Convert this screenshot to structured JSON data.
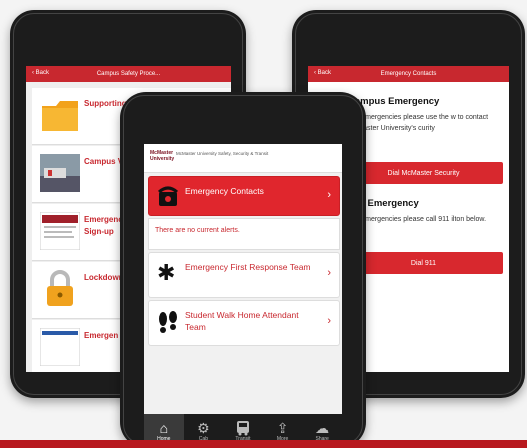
{
  "left_phone": {
    "back_label": "‹ Back",
    "title": "Campus Safety Proce...",
    "rows": [
      {
        "label": "Supporting",
        "icon": "folder-icon"
      },
      {
        "label": "Campus V",
        "icon": "photo-icon"
      },
      {
        "label": "Emergenc\nSign-up",
        "icon": "document-icon"
      },
      {
        "label": "Lockdown",
        "icon": "padlock-icon"
      },
      {
        "label": "Emergen",
        "icon": "document-icon"
      }
    ]
  },
  "right_phone": {
    "back_label": "‹ Back",
    "title": "Emergency Contacts",
    "section1_heading": "Campus Emergency",
    "section1_text": "pus emergencies please use the w to contact McMaster University's curity",
    "button1": "Dial McMaster Security",
    "section2_heading": "pus Emergency",
    "section2_text": "ous emergencies please call 911 ilton below.",
    "button2": "Dial 911"
  },
  "center_phone": {
    "header_logo": "McMaster University",
    "header_sub": "McMaster University Safety, Security & Transit",
    "emergency_contacts": "Emergency Contacts",
    "alerts": "There are no current alerts.",
    "first_response": "Emergency First Response Team",
    "walk_home": "Student Walk Home Attendant Team",
    "chevron": "›",
    "nav": [
      {
        "label": "Home",
        "icon": "home-icon"
      },
      {
        "label": "Cab",
        "icon": "gear-icon"
      },
      {
        "label": "Transit",
        "icon": "bus-icon"
      },
      {
        "label": "More",
        "icon": "share-icon"
      },
      {
        "label": "Share",
        "icon": "chat-icon"
      }
    ]
  },
  "colors": {
    "brand_red": "#c8282f",
    "phone_body": "#1c1c1c"
  }
}
